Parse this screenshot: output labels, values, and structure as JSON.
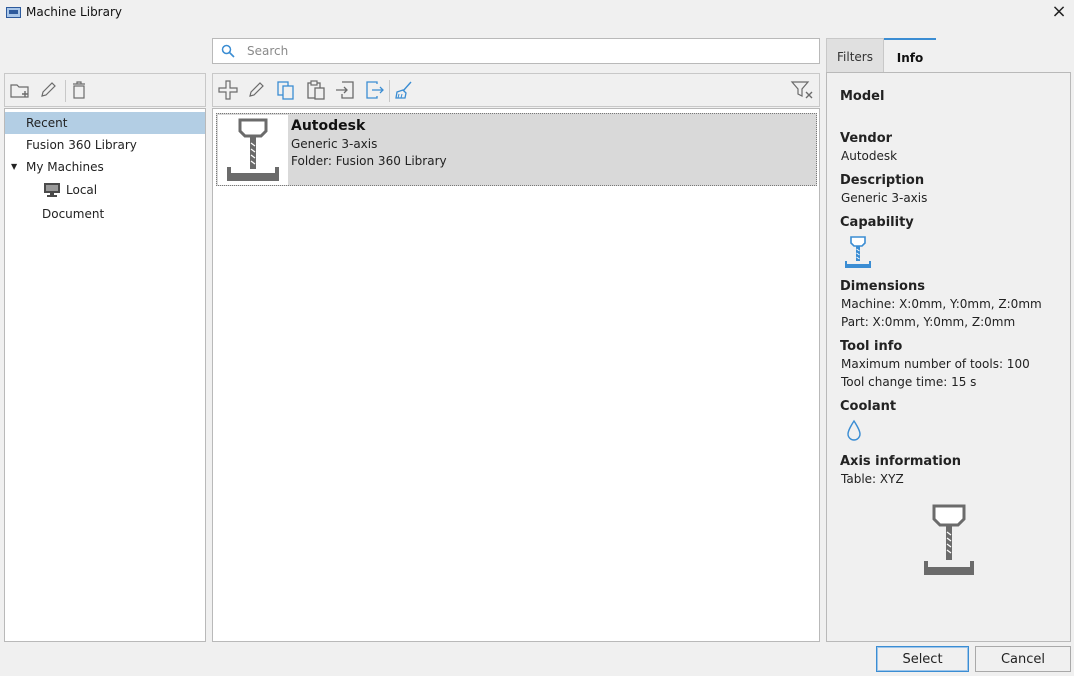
{
  "window": {
    "title": "Machine Library"
  },
  "search": {
    "placeholder": "Search"
  },
  "tree": {
    "items": [
      {
        "label": "Recent"
      },
      {
        "label": "Fusion 360 Library"
      },
      {
        "label": "My Machines"
      },
      {
        "label": "Local"
      },
      {
        "label": "Document"
      }
    ]
  },
  "machines": [
    {
      "name": "Autodesk",
      "model": "Generic 3-axis",
      "folder": "Folder: Fusion 360 Library"
    }
  ],
  "tabs": {
    "filters": "Filters",
    "info": "Info"
  },
  "info": {
    "model_heading": "Model",
    "vendor_heading": "Vendor",
    "vendor": "Autodesk",
    "description_heading": "Description",
    "description": "Generic 3-axis",
    "capability_heading": "Capability",
    "dimensions_heading": "Dimensions",
    "dim_machine": "Machine: X:0mm, Y:0mm, Z:0mm",
    "dim_part": "Part: X:0mm, Y:0mm, Z:0mm",
    "tool_heading": "Tool info",
    "tool_max": "Maximum number of tools: 100",
    "tool_change": "Tool change time: 15 s",
    "coolant_heading": "Coolant",
    "axis_heading": "Axis information",
    "axis_table": "Table: XYZ"
  },
  "buttons": {
    "select": "Select",
    "cancel": "Cancel"
  },
  "colors": {
    "accent": "#3b8dd3",
    "selection": "#b3cee4",
    "icon_gray": "#6b6b6b"
  }
}
